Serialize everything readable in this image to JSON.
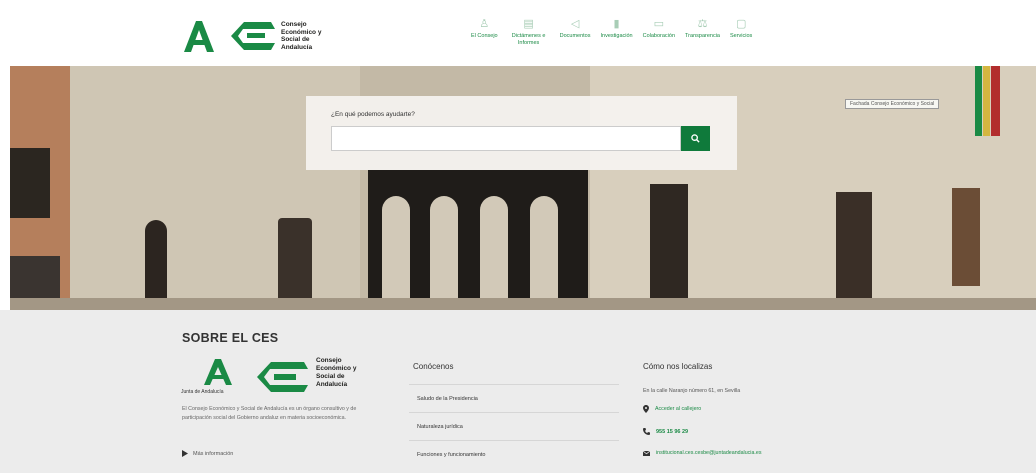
{
  "brand": {
    "name_line1": "Consejo",
    "name_line2": "Económico y",
    "name_line3": "Social de",
    "name_line4": "Andalucía",
    "color_green": "#1a8a45",
    "color_dark_green": "#0f7a3b"
  },
  "nav": {
    "items": [
      {
        "label": "El Consejo",
        "icon": "person-icon"
      },
      {
        "label": "Dictámenes e Informes",
        "icon": "document-stack-icon"
      },
      {
        "label": "Documentos",
        "icon": "megaphone-icon"
      },
      {
        "label": "Investigación",
        "icon": "chart-icon"
      },
      {
        "label": "Colaboración",
        "icon": "handshake-icon"
      },
      {
        "label": "Transparencia",
        "icon": "scale-icon"
      },
      {
        "label": "Servicios",
        "icon": "monitor-icon"
      }
    ]
  },
  "hero": {
    "tooltip": "Fachada Consejo Económico y Social",
    "search_label": "¿En qué podemos ayudarte?",
    "search_value": "",
    "search_placeholder": "",
    "search_icon": "search-icon"
  },
  "footer": {
    "title": "SOBRE EL CES",
    "junta": "Junta de Andalucía",
    "description": "El Consejo Económico y Social de Andalucía es un órgano consultivo y de participación social del Gobierno andaluz en materia socioeconómica.",
    "more_label": "Más información",
    "conocenos": {
      "title": "Conócenos",
      "items": [
        "Saludo de la Presidencia",
        "Naturaleza jurídica",
        "Funciones y funcionamiento"
      ]
    },
    "contact": {
      "title": "Cómo nos localizas",
      "address": "En la calle Naranjo número 61, en Sevilla",
      "map_link": "Acceder al callejero",
      "phone": "955 15 96 29",
      "email": "institucional.ces.cesbe@juntadeandalucia.es"
    }
  }
}
